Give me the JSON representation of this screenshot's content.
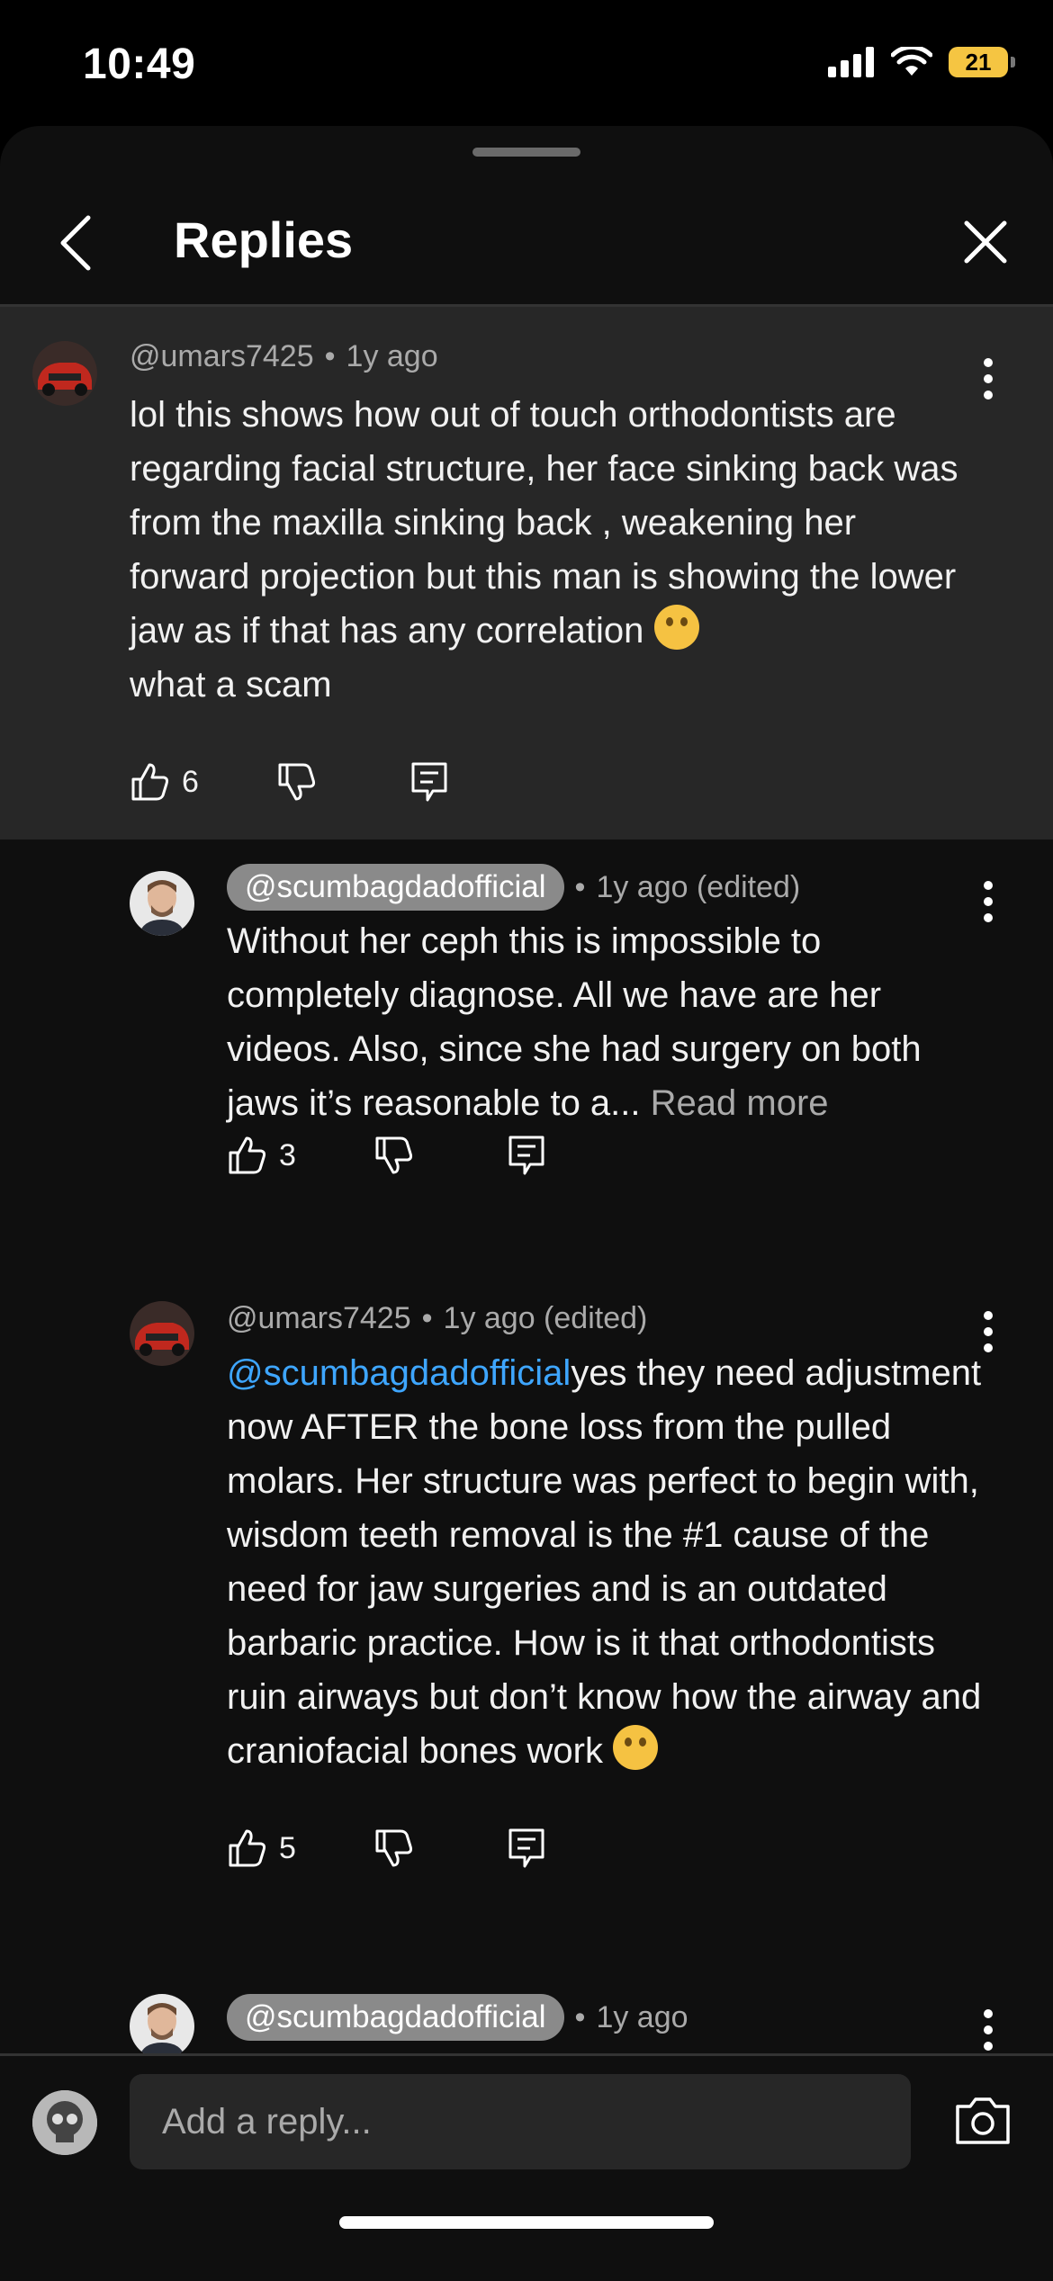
{
  "status": {
    "time": "10:49",
    "battery": "21",
    "icons": [
      "cellular-signal-icon",
      "wifi-icon",
      "battery-charging-icon"
    ]
  },
  "header": {
    "title": "Replies",
    "back_icon": "chevron-left-icon",
    "close_icon": "close-icon"
  },
  "comments": [
    {
      "handle": "@umars7425",
      "time": "1y ago",
      "text": "lol this shows how out of touch orthodontists are regarding facial structure, her face sinking back was from the maxilla sinking back , weakening her forward projection but this man is showing the lower jaw as if that has any correlation",
      "text_tail": "what a scam",
      "likes": "6",
      "emoji": "rolling-on-floor-laughing-emoji"
    },
    {
      "handle": "@scumbagdadofficial",
      "time": "1y ago (edited)",
      "text": "Without her ceph this is impossible to completely diagnose. All we have are her videos. Also, since she had surgery on both jaws it’s reasonable to a...",
      "read_more": "Read more",
      "likes": "3"
    },
    {
      "handle": "@umars7425",
      "time": "1y ago (edited)",
      "mention": "@scumbagdadofficial",
      "text": "yes they need adjustment now AFTER the bone loss from the pulled molars. Her structure was perfect to begin with, wisdom teeth removal is the #1 cause of the need for jaw surgeries and is an outdated barbaric practice. How is it that orthodontists ruin airways but don’t know how the airway and craniofacial bones work",
      "emoji": "thinking-face-emoji",
      "likes": "5"
    },
    {
      "handle": "@scumbagdadofficial",
      "time": "1y ago"
    }
  ],
  "reply_bar": {
    "placeholder": "Add a reply...",
    "camera_icon": "camera-icon"
  },
  "colors": {
    "background": "#0f0f0f",
    "highlight": "#272727",
    "mention": "#3ea6ff",
    "battery": "#f5c542"
  }
}
